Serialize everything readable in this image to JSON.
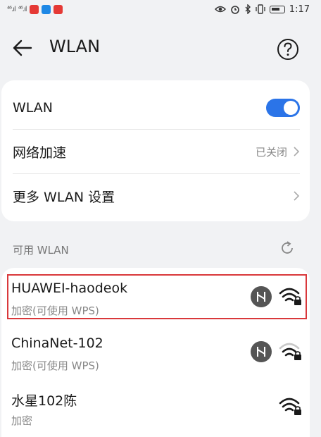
{
  "status_bar": {
    "signal1": "⁴⁶.ıl",
    "signal2": "⁴⁶.ıl",
    "time": "1:17",
    "app_badge_colors": [
      "#e53935",
      "#1e88e5",
      "#e53935"
    ]
  },
  "header": {
    "title": "WLAN",
    "back_icon": "arrow-left",
    "help_icon": "question-circle"
  },
  "settings": {
    "wlan_label": "WLAN",
    "wlan_enabled": true,
    "network_accel_label": "网络加速",
    "network_accel_value": "已关闭",
    "more_settings_label": "更多 WLAN 设置"
  },
  "available": {
    "section_label": "可用 WLAN",
    "networks": [
      {
        "name": "HUAWEI-haodeok",
        "security": "加密(可使用 WPS)",
        "wps": true,
        "selected": true
      },
      {
        "name": "ChinaNet-102",
        "security": "加密(可使用 WPS)",
        "wps": true,
        "selected": false
      },
      {
        "name": "水星102陈",
        "security": "加密",
        "wps": false,
        "selected": false
      }
    ]
  },
  "colors": {
    "accent": "#2b74e8",
    "highlight_border": "#d9383b",
    "background": "#f1f2f4"
  }
}
